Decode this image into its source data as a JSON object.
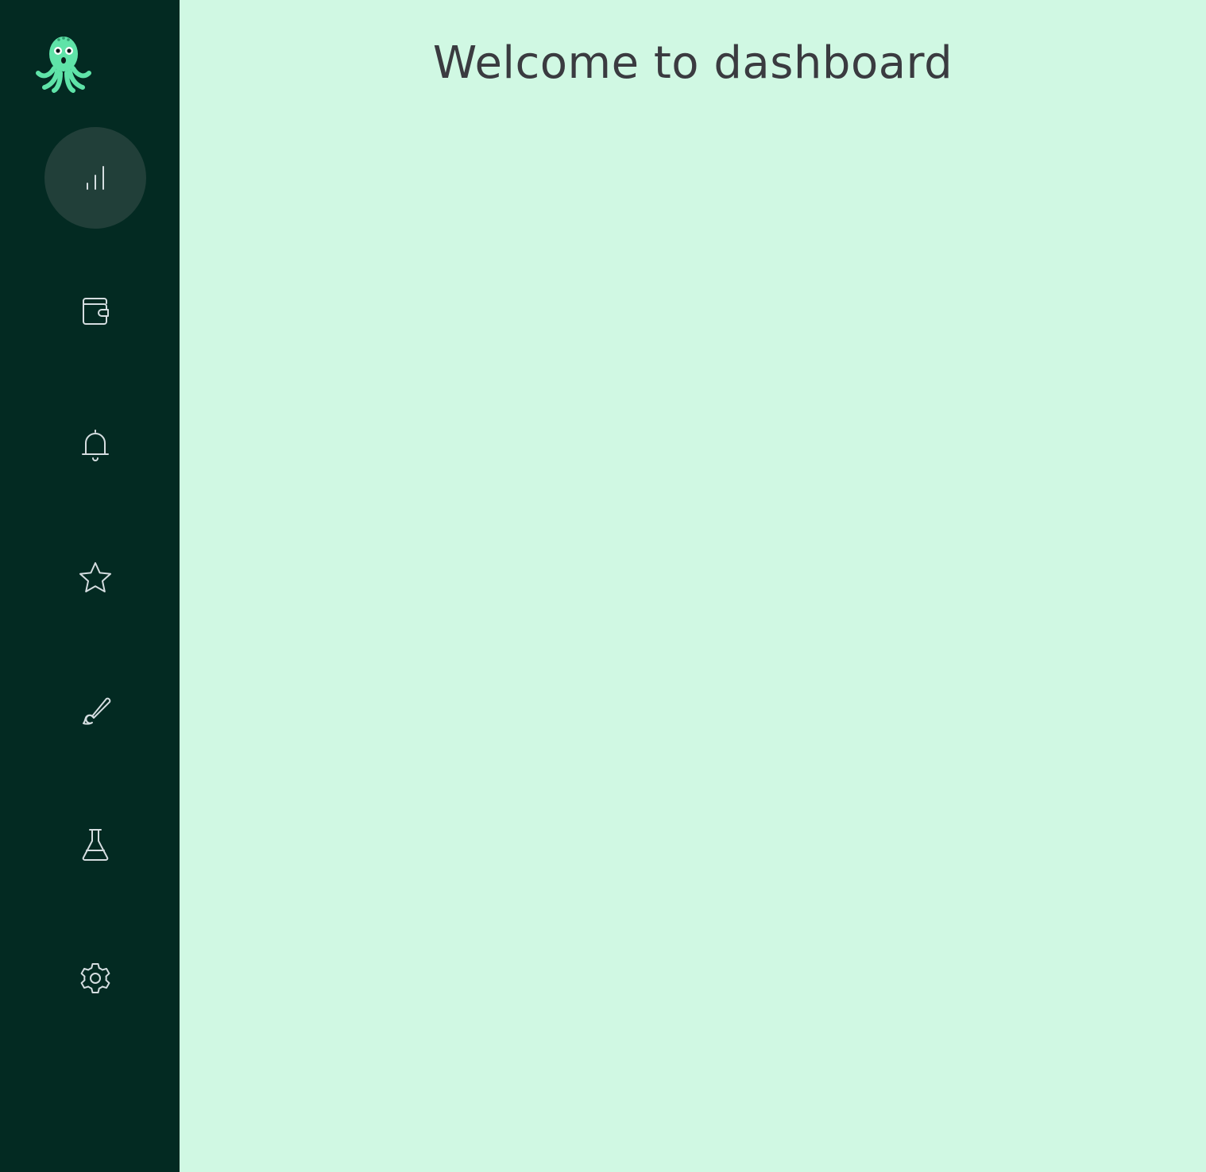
{
  "app": {
    "logo_icon": "octopus-icon"
  },
  "colors": {
    "sidebar_bg": "#032a22",
    "active_item_bg": "#213f39",
    "icon_stroke": "#d5dde0",
    "main_bg": "#d0f8e3",
    "title_text": "#3a3b40",
    "logo_body": "#5fe3a8"
  },
  "sidebar": {
    "items": [
      {
        "icon": "bar-chart-icon",
        "active": true
      },
      {
        "icon": "wallet-icon",
        "active": false
      },
      {
        "icon": "bell-icon",
        "active": false
      },
      {
        "icon": "star-icon",
        "active": false
      },
      {
        "icon": "brush-icon",
        "active": false
      },
      {
        "icon": "flask-icon",
        "active": false
      },
      {
        "icon": "gear-icon",
        "active": false
      }
    ]
  },
  "main": {
    "title": "Welcome to dashboard"
  }
}
